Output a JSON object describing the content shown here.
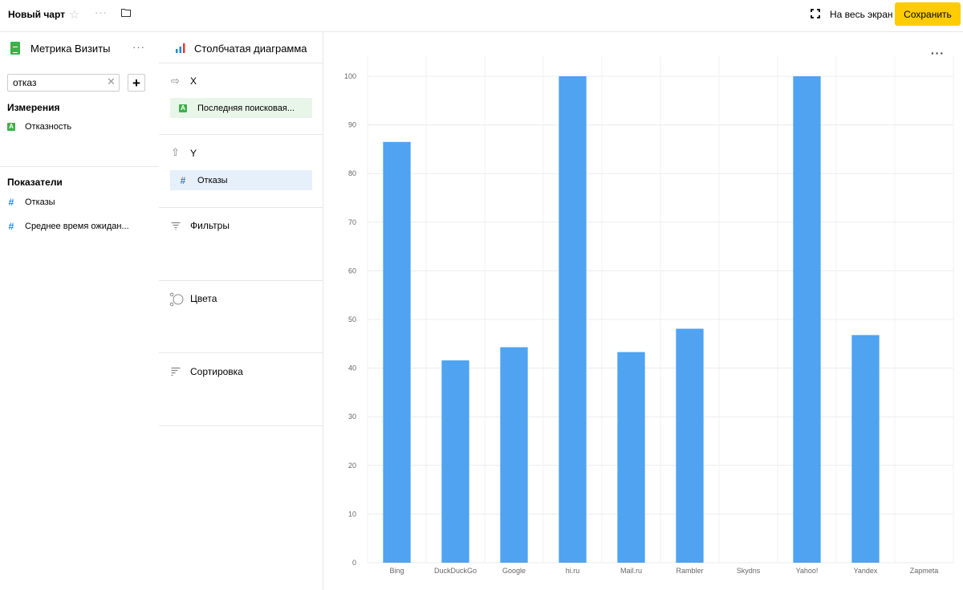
{
  "topbar": {
    "title": "Новый чарт",
    "fullscreen_label": "На весь экран",
    "save_label": "Сохранить",
    "save_color": "#ffcc00"
  },
  "dataset": {
    "name": "Метрика Визиты",
    "search_value": "отказ",
    "dimensions_title": "Измерения",
    "dimensions": [
      "Отказность"
    ],
    "measures_title": "Показатели",
    "measures": [
      "Отказы",
      "Среднее время ожидан..."
    ]
  },
  "visualization": {
    "name": "Столбчатая диаграмма",
    "x_label": "X",
    "x_field": "Последняя поисковая...",
    "y_label": "Y",
    "y_field": "Отказы",
    "filters_label": "Фильтры",
    "colors_label": "Цвета",
    "sort_label": "Сортировка"
  },
  "chart_data": {
    "type": "bar",
    "categories": [
      "Bing",
      "DuckDuckGo",
      "Google",
      "hi.ru",
      "Mail.ru",
      "Rambler",
      "Skydns",
      "Yahoo!",
      "Yandex",
      "Zapmeta"
    ],
    "values": [
      86.5,
      41.6,
      44.3,
      100,
      43.3,
      48.1,
      null,
      100,
      46.8,
      null
    ],
    "ylim": [
      0,
      100
    ],
    "yticks": [
      0,
      10,
      20,
      30,
      40,
      50,
      60,
      70,
      80,
      90,
      100
    ],
    "grid": true,
    "bar_color": "#4fa3f0"
  }
}
